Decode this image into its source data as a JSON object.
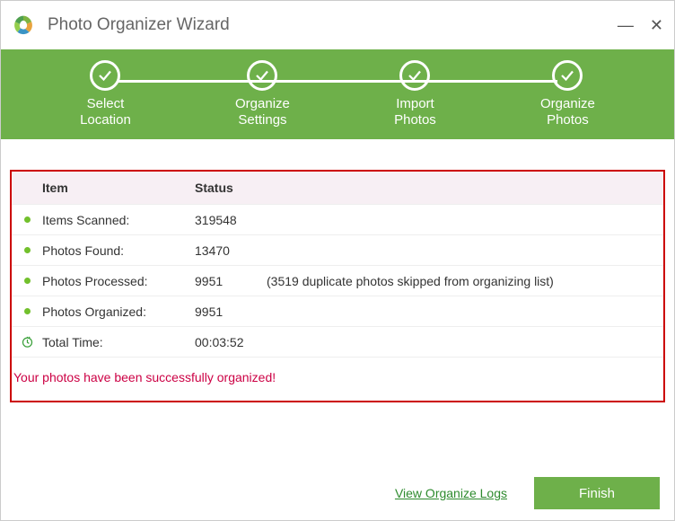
{
  "window": {
    "title": "Photo Organizer Wizard"
  },
  "steps": [
    {
      "line1": "Select",
      "line2": "Location"
    },
    {
      "line1": "Organize",
      "line2": "Settings"
    },
    {
      "line1": "Import",
      "line2": "Photos"
    },
    {
      "line1": "Organize",
      "line2": "Photos"
    }
  ],
  "table": {
    "header_item": "Item",
    "header_status": "Status",
    "rows": [
      {
        "label": "Items Scanned:",
        "value": "319548",
        "note": ""
      },
      {
        "label": "Photos Found:",
        "value": "13470",
        "note": ""
      },
      {
        "label": "Photos Processed:",
        "value": "9951",
        "note": "(3519 duplicate photos skipped from organizing list)"
      },
      {
        "label": "Photos Organized:",
        "value": "9951",
        "note": ""
      }
    ],
    "total_time_label": "Total Time:",
    "total_time_value": "00:03:52"
  },
  "success_message": "Your photos have been successfully organized!",
  "footer": {
    "log_link": "View Organize Logs",
    "finish_label": "Finish"
  }
}
